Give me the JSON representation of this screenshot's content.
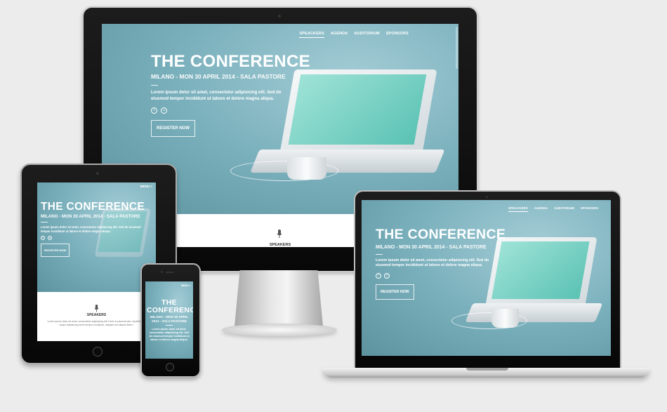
{
  "site": {
    "title": "THE CONFERENCE",
    "subtitle": "MILANO - MON 30 APRIL 2014 - SALA PASTORE",
    "lead": "Lorem ipsum dolor sit amet, consectetur adipisicing elit. Sed do eiusmod tempor incididunt ut labore et dolore magna aliqua.",
    "register_label": "REGISTER NOW",
    "social": [
      {
        "icon": "facebook-icon",
        "glyph": "f"
      },
      {
        "icon": "vimeo-icon",
        "glyph": "v"
      }
    ]
  },
  "nav": {
    "items": [
      {
        "label": "SPEACKERS",
        "active": true
      },
      {
        "label": "AGENDA",
        "active": false
      },
      {
        "label": "AUDITORIUM",
        "active": false
      },
      {
        "label": "SPONSORS",
        "active": false
      }
    ],
    "menu_label": "MENU",
    "menu_icon": "hamburger-icon"
  },
  "speakers": {
    "heading": "SPEAKERS",
    "text": "Lorem ipsum dolor sit amet, consectetur adipisicing elit. Dolor in placerat sint, repellat non, neque adipiscing lorem tempor incididunt, aliquam nisi aliquet libero."
  },
  "theme": {
    "hero_color": "#7bb1bd",
    "accent_color": "#5ac2b4",
    "text_color": "#ffffff"
  }
}
